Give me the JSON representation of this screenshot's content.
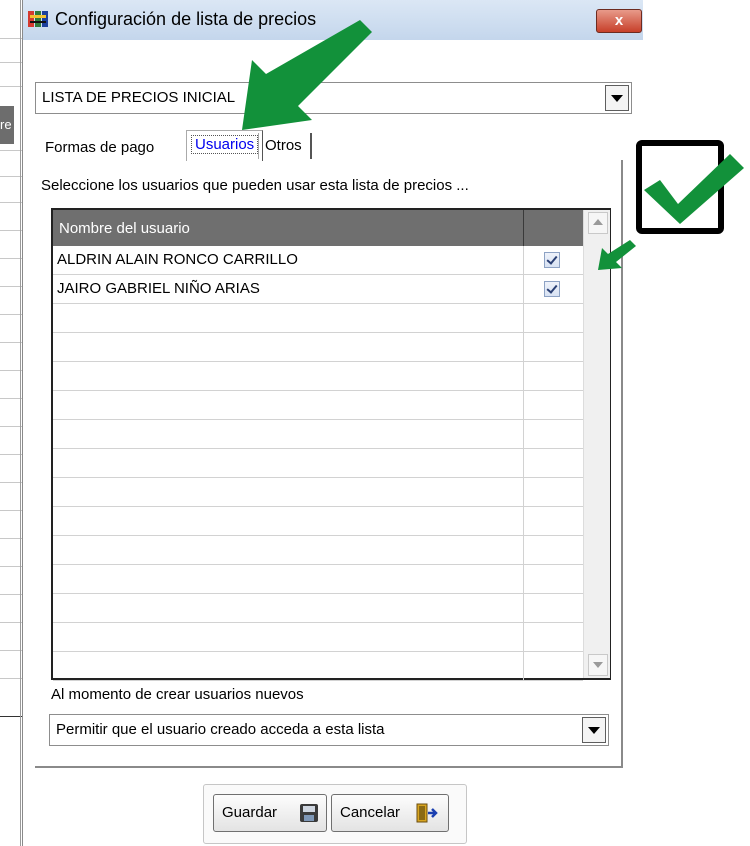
{
  "window": {
    "title": "Configuración de lista de precios",
    "close_label": "x"
  },
  "price_list_select": {
    "value": "LISTA DE PRECIOS INICIAL"
  },
  "tabs": [
    {
      "label": "Formas de pago"
    },
    {
      "label": "Usuarios"
    },
    {
      "label": "Otros"
    }
  ],
  "users_tab": {
    "instruction": "Seleccione los usuarios que pueden usar esta lista de precios ...",
    "column_header": "Nombre del usuario",
    "users": [
      {
        "name": "ALDRIN ALAIN RONCO CARRILLO",
        "checked": true
      },
      {
        "name": "JAIRO GABRIEL NIÑO ARIAS",
        "checked": true
      }
    ],
    "new_users_label": "Al momento de crear usuarios nuevos",
    "new_users_option": "Permitir que el usuario creado acceda a esta lista"
  },
  "buttons": {
    "save_label": "Guardar",
    "cancel_label": "Cancelar"
  },
  "background_app": {
    "tab_fragment": "re"
  },
  "annotation_colors": {
    "arrow": "#12913a",
    "check": "#12913a"
  }
}
